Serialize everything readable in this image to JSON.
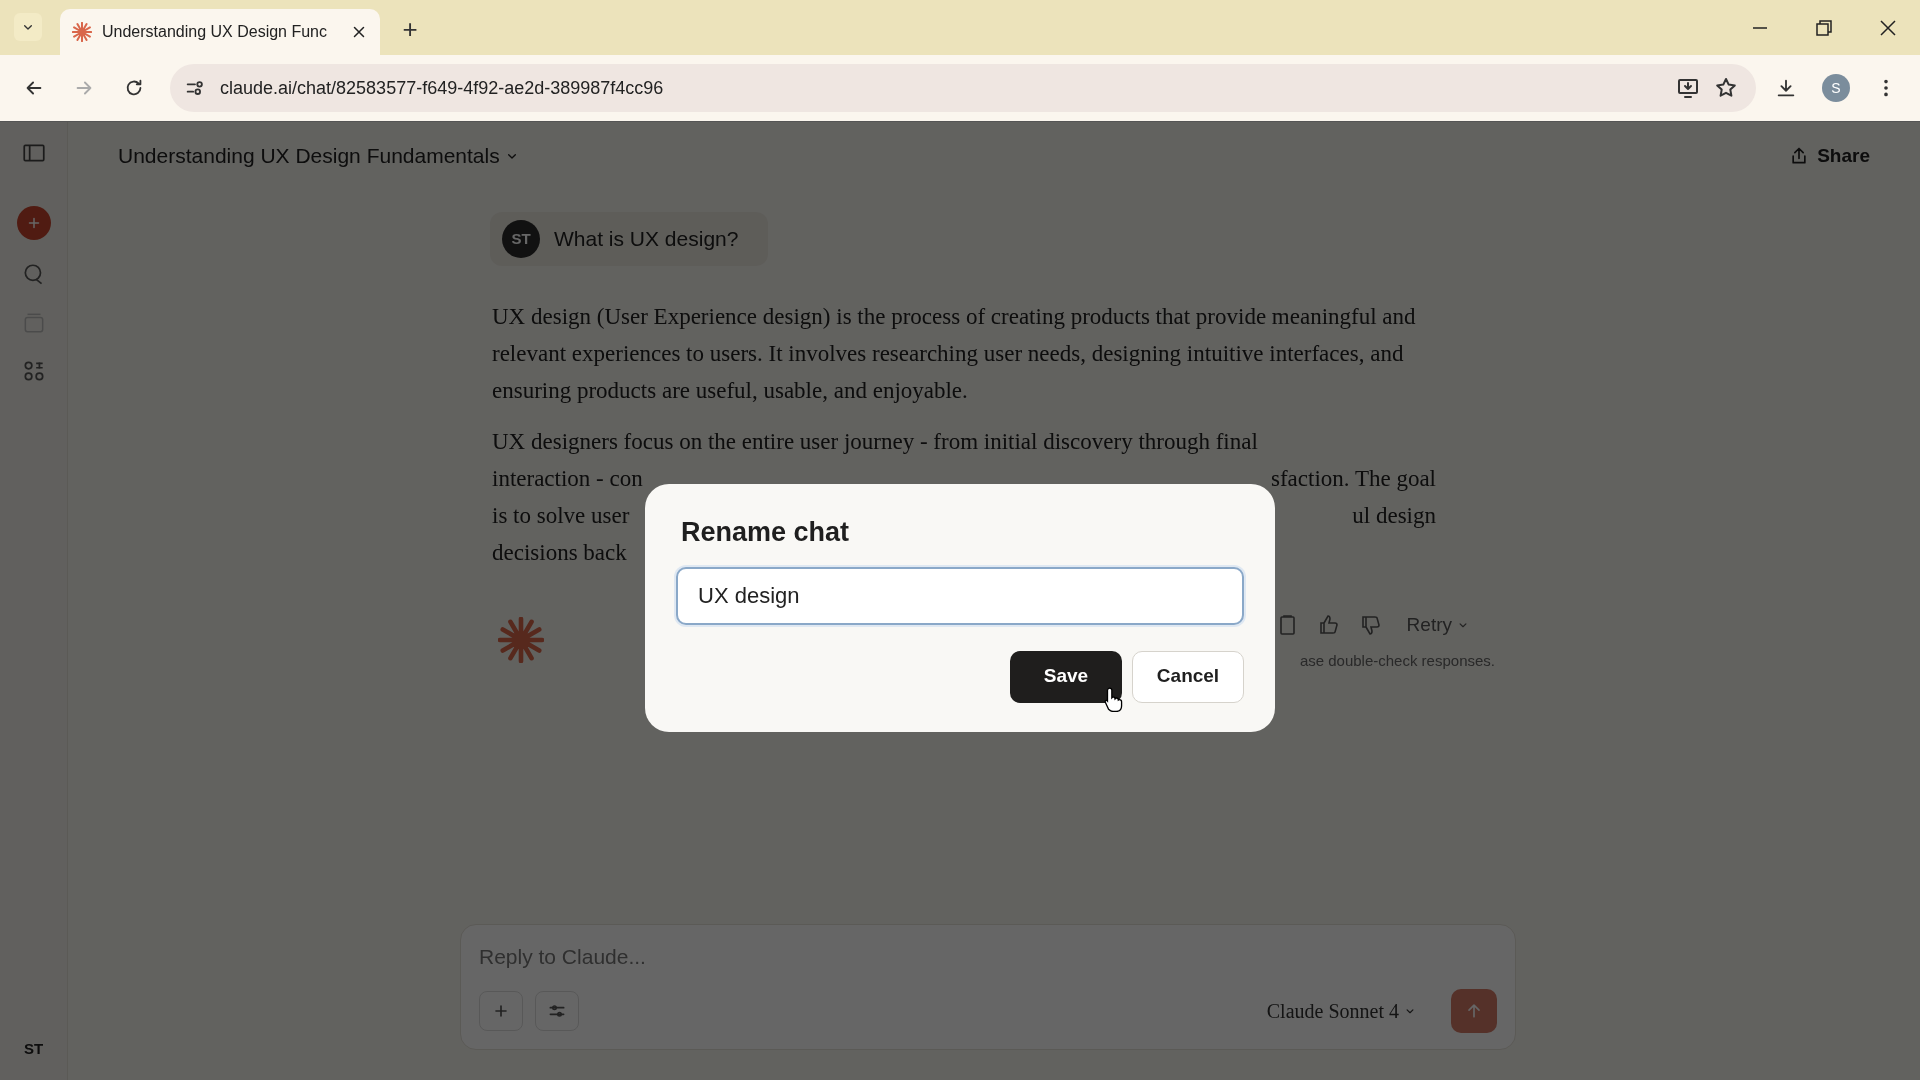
{
  "browser": {
    "tab": {
      "title": "Understanding UX Design Func",
      "selected": true
    },
    "new_tab": "+",
    "url": "claude.ai/chat/82583577-f649-4f92-ae2d-389987f4cc96",
    "profile": "S"
  },
  "sidebar": {
    "avatar": "ST"
  },
  "header": {
    "title": "Understanding UX Design Fundamentals",
    "share": "Share"
  },
  "user_message": {
    "avatar": "ST",
    "text": "What is UX design?"
  },
  "assistant": {
    "paragraph": "UX design (User Experience design) is the process of creating products that provide meaningful and relevant experiences to users. It involves researching user needs, designing intuitive interfaces, and ensuring products are useful, usable, and enjoyable.",
    "lines": [
      {
        "left": "UX designers focus on the entire user journey - from initial discovery through final"
      },
      {
        "left": "interaction - con",
        "right": "sfaction. The goal"
      },
      {
        "left": "is to solve user",
        "right": "ul design"
      },
      {
        "left": "decisions back"
      }
    ],
    "retry": "Retry",
    "disclaimer": "ase double-check responses."
  },
  "composer": {
    "placeholder": "Reply to Claude...",
    "model": "Claude Sonnet 4"
  },
  "dialog": {
    "title": "Rename chat",
    "value": "UX design",
    "buttons": [
      {
        "label": "Save",
        "kind": "primary"
      },
      {
        "label": "Cancel",
        "kind": "secondary"
      }
    ]
  }
}
